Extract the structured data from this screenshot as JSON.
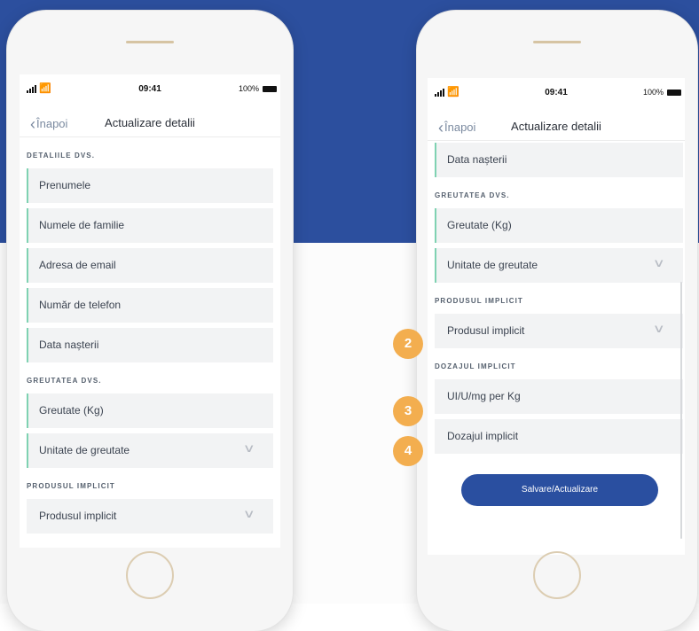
{
  "left_phone": {
    "status": {
      "time": "09:41",
      "battery": "100%"
    },
    "nav": {
      "back_label": "Înapoi",
      "title": "Actualizare detalii"
    },
    "section_details": "DETALIILE DVS.",
    "fields_details": [
      "Prenumele",
      "Numele de familie",
      "Adresa de email",
      "Număr de telefon",
      "Data nașterii"
    ],
    "section_weight": "GREUTATEA DVS.",
    "weight_field": "Greutate (Kg)",
    "weight_unit_field": "Unitate de greutate",
    "section_product": "PRODUSUL IMPLICIT",
    "product_field": "Produsul implicit"
  },
  "right_phone": {
    "status": {
      "time": "09:41",
      "battery": "100%"
    },
    "nav": {
      "back_label": "Înapoi",
      "title": "Actualizare detalii"
    },
    "birth_field": "Data nașterii",
    "section_weight": "GREUTATEA DVS.",
    "weight_field": "Greutate (Kg)",
    "weight_unit_field": "Unitate de greutate",
    "section_product": "PRODUSUL IMPLICIT",
    "product_field": "Produsul implicit",
    "section_dosage": "DOZAJUL IMPLICIT",
    "dosage_unit_field": "UI/U/mg per Kg",
    "dosage_field": "Dozajul implicit",
    "save_button": "Salvare/Actualizare"
  },
  "badges": [
    "2",
    "3",
    "4"
  ],
  "colors": {
    "brand_blue": "#2c4f9e",
    "field_accent": "#7fd2b2",
    "badge": "#f3ae4f",
    "button": "#2a4fa0"
  },
  "icons": {
    "back": "chevron-left-icon",
    "dropdown": "chevron-down-icon",
    "signal": "signal-icon",
    "wifi": "wifi-icon",
    "battery": "battery-icon"
  }
}
